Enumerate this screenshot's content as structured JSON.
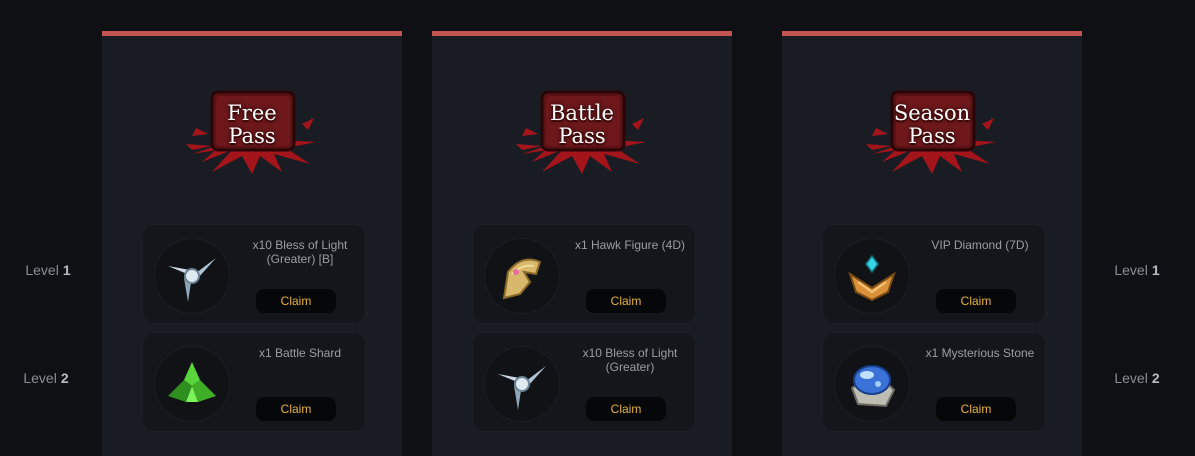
{
  "levels": [
    {
      "prefix": "Level",
      "num": "1"
    },
    {
      "prefix": "Level",
      "num": "2"
    }
  ],
  "passes": [
    {
      "title_line1": "Free",
      "title_line2": "Pass",
      "rewards": [
        {
          "name": "x10 Bless of Light (Greater) [B]",
          "icon": "bless-of-light-icon",
          "claim": "Claim"
        },
        {
          "name": "x1 Battle Shard",
          "icon": "battle-shard-icon",
          "claim": "Claim"
        }
      ]
    },
    {
      "title_line1": "Battle",
      "title_line2": "Pass",
      "rewards": [
        {
          "name": "x1 Hawk Figure (4D)",
          "icon": "hawk-figure-icon",
          "claim": "Claim"
        },
        {
          "name": "x10 Bless of Light (Greater)",
          "icon": "bless-of-light-icon",
          "claim": "Claim"
        }
      ]
    },
    {
      "title_line1": "Season",
      "title_line2": "Pass",
      "rewards": [
        {
          "name": "VIP Diamond (7D)",
          "icon": "vip-diamond-icon",
          "claim": "Claim"
        },
        {
          "name": "x1 Mysterious Stone",
          "icon": "mysterious-stone-icon",
          "claim": "Claim"
        }
      ]
    }
  ],
  "colors": {
    "background": "#0f1014",
    "column": "#191c23",
    "accent_top": "#c4544f",
    "claim_text": "#e8b23d"
  }
}
